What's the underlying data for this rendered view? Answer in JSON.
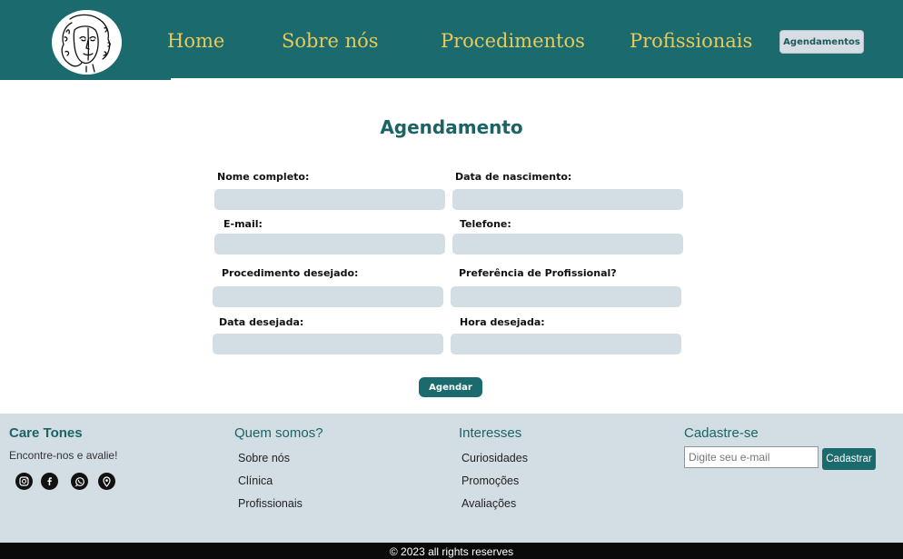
{
  "header": {
    "logo_icon": "woman-face-line-art-icon",
    "nav": [
      {
        "label": "Home"
      },
      {
        "label": "Sobre nós"
      },
      {
        "label": "Procedimentos"
      },
      {
        "label": "Profissionais"
      }
    ],
    "cta_label": "Agendamentos",
    "bg_color": "#1b6b6e",
    "link_color": "#e8c95a"
  },
  "form": {
    "title": "Agendamento",
    "fields": [
      {
        "label": "Nome completo:",
        "value": ""
      },
      {
        "label": "Data de nascimento:",
        "value": ""
      },
      {
        "label": "E-mail:",
        "value": ""
      },
      {
        "label": "Telefone:",
        "value": ""
      },
      {
        "label": "Procedimento desejado:",
        "value": ""
      },
      {
        "label": "Preferência de Profissional?",
        "value": ""
      },
      {
        "label": "Data desejada:",
        "value": ""
      },
      {
        "label": "Hora desejada:",
        "value": ""
      }
    ],
    "submit_label": "Agendar",
    "field_color": "#d3dde4"
  },
  "footer": {
    "brand": {
      "title": "Care Tones",
      "subtitle": "Encontre-nos e avalie!",
      "social_icons": [
        "instagram-icon",
        "facebook-icon",
        "whatsapp-icon",
        "location-pin-icon"
      ]
    },
    "columns": [
      {
        "title": "Quem somos?",
        "links": [
          "Sobre nós",
          "Clínica",
          "Profissionais"
        ]
      },
      {
        "title": "Interesses",
        "links": [
          "Curiosidades",
          "Promoções",
          "Avaliações"
        ]
      }
    ],
    "signup": {
      "title": "Cadastre-se",
      "placeholder": "Digite seu e-mail",
      "button_label": "Cadastrar"
    },
    "bg_color": "#d3dde4"
  },
  "copyright": "© 2023 all rights reserves"
}
